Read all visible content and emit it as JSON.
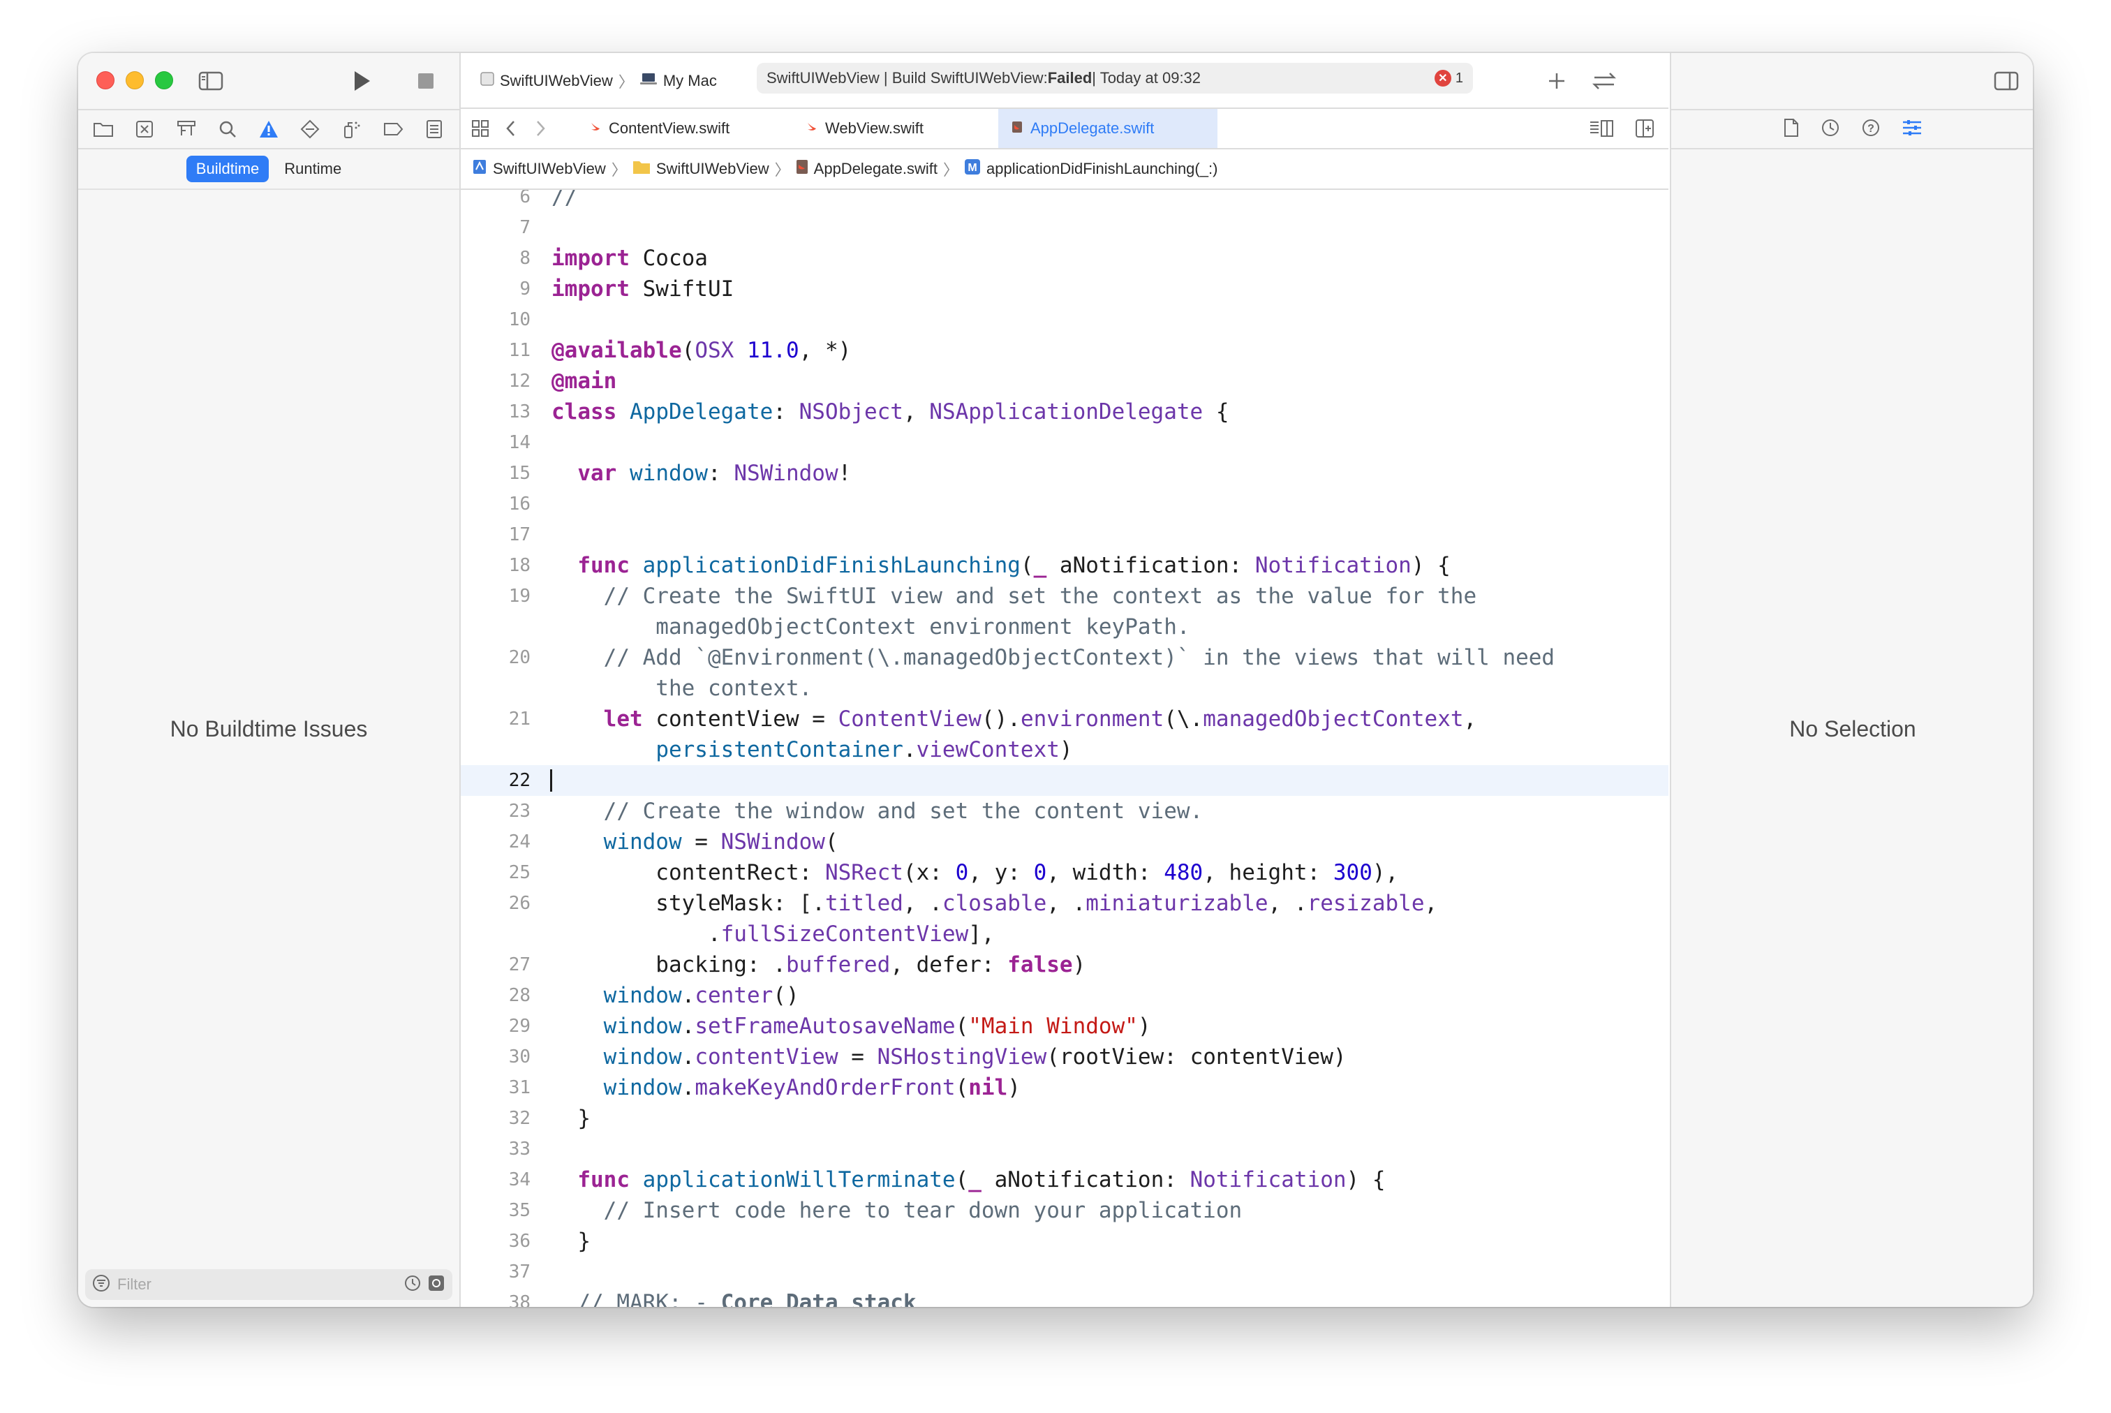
{
  "toolbar": {
    "scheme": "SwiftUIWebView",
    "destination": "My Mac",
    "activity": {
      "prefix": "SwiftUIWebView | Build SwiftUIWebView: ",
      "status": "Failed",
      "suffix": " | Today at 09:32",
      "error_count": "1"
    }
  },
  "navigator": {
    "segments": [
      "Buildtime",
      "Runtime"
    ],
    "active_segment": "Buildtime",
    "empty_message": "No Buildtime Issues",
    "filter_placeholder": "Filter"
  },
  "tabs": [
    {
      "label": "ContentView.swift",
      "active": false
    },
    {
      "label": "WebView.swift",
      "active": false
    },
    {
      "label": "AppDelegate.swift",
      "active": true
    }
  ],
  "jumpbar": [
    "SwiftUIWebView",
    "SwiftUIWebView",
    "AppDelegate.swift",
    "applicationDidFinishLaunching(_:)"
  ],
  "inspector": {
    "empty_message": "No Selection"
  },
  "editor": {
    "current_line": "22",
    "lines": [
      {
        "n": "6",
        "segs": [
          {
            "t": "//",
            "c": "cm"
          }
        ]
      },
      {
        "n": "7",
        "segs": []
      },
      {
        "n": "8",
        "segs": [
          {
            "t": "import",
            "c": "kw"
          },
          {
            "t": " Cocoa",
            "c": ""
          }
        ]
      },
      {
        "n": "9",
        "segs": [
          {
            "t": "import",
            "c": "kw"
          },
          {
            "t": " SwiftUI",
            "c": ""
          }
        ]
      },
      {
        "n": "10",
        "segs": []
      },
      {
        "n": "11",
        "segs": [
          {
            "t": "@available",
            "c": "at"
          },
          {
            "t": "(",
            "c": ""
          },
          {
            "t": "OSX",
            "c": "pt"
          },
          {
            "t": " ",
            "c": ""
          },
          {
            "t": "11.0",
            "c": "nm"
          },
          {
            "t": ", *)",
            "c": ""
          }
        ]
      },
      {
        "n": "12",
        "segs": [
          {
            "t": "@main",
            "c": "at"
          }
        ]
      },
      {
        "n": "13",
        "segs": [
          {
            "t": "class",
            "c": "kw"
          },
          {
            "t": " ",
            "c": ""
          },
          {
            "t": "AppDelegate",
            "c": "de"
          },
          {
            "t": ": ",
            "c": ""
          },
          {
            "t": "NSObject",
            "c": "pt"
          },
          {
            "t": ", ",
            "c": ""
          },
          {
            "t": "NSApplicationDelegate",
            "c": "pt"
          },
          {
            "t": " {",
            "c": ""
          }
        ]
      },
      {
        "n": "14",
        "segs": []
      },
      {
        "n": "15",
        "segs": [
          {
            "t": "  ",
            "c": ""
          },
          {
            "t": "var",
            "c": "kw"
          },
          {
            "t": " ",
            "c": ""
          },
          {
            "t": "window",
            "c": "de"
          },
          {
            "t": ": ",
            "c": ""
          },
          {
            "t": "NSWindow",
            "c": "pt"
          },
          {
            "t": "!",
            "c": ""
          }
        ]
      },
      {
        "n": "16",
        "segs": []
      },
      {
        "n": "17",
        "segs": []
      },
      {
        "n": "18",
        "segs": [
          {
            "t": "  ",
            "c": ""
          },
          {
            "t": "func",
            "c": "kw"
          },
          {
            "t": " ",
            "c": ""
          },
          {
            "t": "applicationDidFinishLaunching",
            "c": "de"
          },
          {
            "t": "(",
            "c": ""
          },
          {
            "t": "_",
            "c": "kw"
          },
          {
            "t": " aNotification: ",
            "c": ""
          },
          {
            "t": "Notification",
            "c": "pt"
          },
          {
            "t": ") {",
            "c": ""
          }
        ]
      },
      {
        "n": "19",
        "segs": [
          {
            "t": "    // Create the SwiftUI view and set the context as the value for the",
            "c": "cm"
          }
        ]
      },
      {
        "n": "",
        "segs": [
          {
            "t": "        managedObjectContext environment keyPath.",
            "c": "cm"
          }
        ]
      },
      {
        "n": "20",
        "segs": [
          {
            "t": "    // Add `@Environment(\\.managedObjectContext)` in the views that will need",
            "c": "cm"
          }
        ]
      },
      {
        "n": "",
        "segs": [
          {
            "t": "        the context.",
            "c": "cm"
          }
        ]
      },
      {
        "n": "21",
        "segs": [
          {
            "t": "    ",
            "c": ""
          },
          {
            "t": "let",
            "c": "kw"
          },
          {
            "t": " contentView = ",
            "c": ""
          },
          {
            "t": "ContentView",
            "c": "pt"
          },
          {
            "t": "().",
            "c": ""
          },
          {
            "t": "environment",
            "c": "pt"
          },
          {
            "t": "(\\.",
            "c": ""
          },
          {
            "t": "managedObjectContext",
            "c": "pt"
          },
          {
            "t": ",",
            "c": ""
          }
        ]
      },
      {
        "n": "",
        "segs": [
          {
            "t": "        ",
            "c": ""
          },
          {
            "t": "persistentContainer",
            "c": "de"
          },
          {
            "t": ".",
            "c": ""
          },
          {
            "t": "viewContext",
            "c": "pt"
          },
          {
            "t": ")",
            "c": ""
          }
        ]
      },
      {
        "n": "22",
        "segs": []
      },
      {
        "n": "23",
        "segs": [
          {
            "t": "    // Create the window and set the content view.",
            "c": "cm"
          }
        ]
      },
      {
        "n": "24",
        "segs": [
          {
            "t": "    ",
            "c": ""
          },
          {
            "t": "window",
            "c": "de"
          },
          {
            "t": " = ",
            "c": ""
          },
          {
            "t": "NSWindow",
            "c": "pt"
          },
          {
            "t": "(",
            "c": ""
          }
        ]
      },
      {
        "n": "25",
        "segs": [
          {
            "t": "        contentRect: ",
            "c": ""
          },
          {
            "t": "NSRect",
            "c": "pt"
          },
          {
            "t": "(x: ",
            "c": ""
          },
          {
            "t": "0",
            "c": "nm"
          },
          {
            "t": ", y: ",
            "c": ""
          },
          {
            "t": "0",
            "c": "nm"
          },
          {
            "t": ", width: ",
            "c": ""
          },
          {
            "t": "480",
            "c": "nm"
          },
          {
            "t": ", height: ",
            "c": ""
          },
          {
            "t": "300",
            "c": "nm"
          },
          {
            "t": "),",
            "c": ""
          }
        ]
      },
      {
        "n": "26",
        "segs": [
          {
            "t": "        styleMask: [.",
            "c": ""
          },
          {
            "t": "titled",
            "c": "pt"
          },
          {
            "t": ", .",
            "c": ""
          },
          {
            "t": "closable",
            "c": "pt"
          },
          {
            "t": ", .",
            "c": ""
          },
          {
            "t": "miniaturizable",
            "c": "pt"
          },
          {
            "t": ", .",
            "c": ""
          },
          {
            "t": "resizable",
            "c": "pt"
          },
          {
            "t": ",",
            "c": ""
          }
        ]
      },
      {
        "n": "",
        "segs": [
          {
            "t": "            .",
            "c": ""
          },
          {
            "t": "fullSizeContentView",
            "c": "pt"
          },
          {
            "t": "],",
            "c": ""
          }
        ]
      },
      {
        "n": "27",
        "segs": [
          {
            "t": "        backing: .",
            "c": ""
          },
          {
            "t": "buffered",
            "c": "pt"
          },
          {
            "t": ", defer: ",
            "c": ""
          },
          {
            "t": "false",
            "c": "kw"
          },
          {
            "t": ")",
            "c": ""
          }
        ]
      },
      {
        "n": "28",
        "segs": [
          {
            "t": "    ",
            "c": ""
          },
          {
            "t": "window",
            "c": "de"
          },
          {
            "t": ".",
            "c": ""
          },
          {
            "t": "center",
            "c": "pt"
          },
          {
            "t": "()",
            "c": ""
          }
        ]
      },
      {
        "n": "29",
        "segs": [
          {
            "t": "    ",
            "c": ""
          },
          {
            "t": "window",
            "c": "de"
          },
          {
            "t": ".",
            "c": ""
          },
          {
            "t": "setFrameAutosaveName",
            "c": "pt"
          },
          {
            "t": "(",
            "c": ""
          },
          {
            "t": "\"Main Window\"",
            "c": "st"
          },
          {
            "t": ")",
            "c": ""
          }
        ]
      },
      {
        "n": "30",
        "segs": [
          {
            "t": "    ",
            "c": ""
          },
          {
            "t": "window",
            "c": "de"
          },
          {
            "t": ".",
            "c": ""
          },
          {
            "t": "contentView",
            "c": "pt"
          },
          {
            "t": " = ",
            "c": ""
          },
          {
            "t": "NSHostingView",
            "c": "pt"
          },
          {
            "t": "(rootView: contentView)",
            "c": ""
          }
        ]
      },
      {
        "n": "31",
        "segs": [
          {
            "t": "    ",
            "c": ""
          },
          {
            "t": "window",
            "c": "de"
          },
          {
            "t": ".",
            "c": ""
          },
          {
            "t": "makeKeyAndOrderFront",
            "c": "pt"
          },
          {
            "t": "(",
            "c": ""
          },
          {
            "t": "nil",
            "c": "kw"
          },
          {
            "t": ")",
            "c": ""
          }
        ]
      },
      {
        "n": "32",
        "segs": [
          {
            "t": "  }",
            "c": ""
          }
        ]
      },
      {
        "n": "33",
        "segs": []
      },
      {
        "n": "34",
        "segs": [
          {
            "t": "  ",
            "c": ""
          },
          {
            "t": "func",
            "c": "kw"
          },
          {
            "t": " ",
            "c": ""
          },
          {
            "t": "applicationWillTerminate",
            "c": "de"
          },
          {
            "t": "(",
            "c": ""
          },
          {
            "t": "_",
            "c": "kw"
          },
          {
            "t": " aNotification: ",
            "c": ""
          },
          {
            "t": "Notification",
            "c": "pt"
          },
          {
            "t": ") {",
            "c": ""
          }
        ]
      },
      {
        "n": "35",
        "segs": [
          {
            "t": "    // Insert code here to tear down your application",
            "c": "cm"
          }
        ]
      },
      {
        "n": "36",
        "segs": [
          {
            "t": "  }",
            "c": ""
          }
        ]
      },
      {
        "n": "37",
        "segs": []
      },
      {
        "n": "38",
        "segs": [
          {
            "t": "  // MARK: - ",
            "c": "cm"
          },
          {
            "t": "Core Data stack",
            "c": "mk"
          }
        ]
      }
    ]
  }
}
